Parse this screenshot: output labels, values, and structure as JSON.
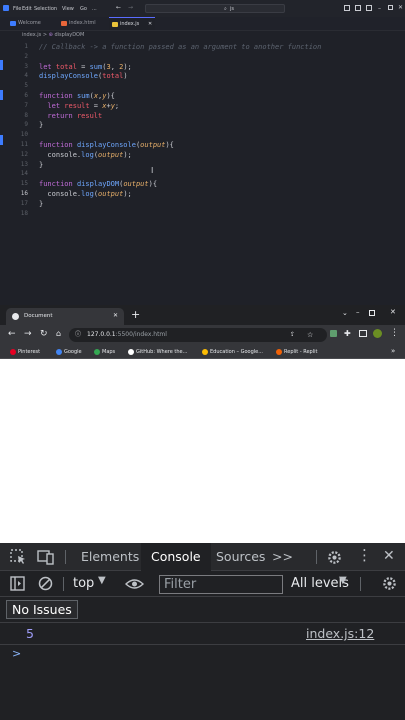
{
  "editor": {
    "menu": [
      "File",
      "Edit",
      "Selection",
      "View",
      "Go",
      "..."
    ],
    "search_placeholder": "js",
    "tabs": [
      {
        "label": "Welcome",
        "active": false
      },
      {
        "label": "index.html",
        "active": false
      },
      {
        "label": "index.js",
        "active": true
      }
    ],
    "breadcrumb": [
      "index.js",
      "displayDOM"
    ],
    "lines": [
      {
        "n": "1",
        "segs": [
          {
            "c": "cm",
            "t": "// Callback -> a function passed as an argument to another function"
          }
        ]
      },
      {
        "n": "2",
        "segs": []
      },
      {
        "n": "3",
        "segs": [
          {
            "c": "kw",
            "t": "let "
          },
          {
            "c": "var",
            "t": "total"
          },
          {
            "c": "p",
            "t": " = "
          },
          {
            "c": "fn",
            "t": "sum"
          },
          {
            "c": "p",
            "t": "("
          },
          {
            "c": "num-lit",
            "t": "3"
          },
          {
            "c": "p",
            "t": ", "
          },
          {
            "c": "num-lit",
            "t": "2"
          },
          {
            "c": "p",
            "t": ");"
          }
        ]
      },
      {
        "n": "4",
        "segs": [
          {
            "c": "fn",
            "t": "displayConsole"
          },
          {
            "c": "p",
            "t": "("
          },
          {
            "c": "var",
            "t": "total"
          },
          {
            "c": "p",
            "t": ")"
          }
        ]
      },
      {
        "n": "5",
        "segs": []
      },
      {
        "n": "6",
        "segs": [
          {
            "c": "kw",
            "t": "function "
          },
          {
            "c": "fn",
            "t": "sum"
          },
          {
            "c": "p",
            "t": "("
          },
          {
            "c": "par",
            "t": "x"
          },
          {
            "c": "p",
            "t": ","
          },
          {
            "c": "par",
            "t": "y"
          },
          {
            "c": "p",
            "t": "){"
          }
        ]
      },
      {
        "n": "7",
        "segs": [
          {
            "c": "kw",
            "t": "  let "
          },
          {
            "c": "var",
            "t": "result"
          },
          {
            "c": "p",
            "t": " = "
          },
          {
            "c": "par",
            "t": "x"
          },
          {
            "c": "p",
            "t": "+"
          },
          {
            "c": "par",
            "t": "y"
          },
          {
            "c": "p",
            "t": ";"
          }
        ]
      },
      {
        "n": "8",
        "segs": [
          {
            "c": "kw",
            "t": "  return "
          },
          {
            "c": "var",
            "t": "result"
          }
        ]
      },
      {
        "n": "9",
        "segs": [
          {
            "c": "p",
            "t": "}"
          }
        ]
      },
      {
        "n": "10",
        "segs": []
      },
      {
        "n": "11",
        "segs": [
          {
            "c": "kw",
            "t": "function "
          },
          {
            "c": "fn",
            "t": "displayConsole"
          },
          {
            "c": "p",
            "t": "("
          },
          {
            "c": "par",
            "t": "output"
          },
          {
            "c": "p",
            "t": "){"
          }
        ]
      },
      {
        "n": "12",
        "segs": [
          {
            "c": "p",
            "t": "  console."
          },
          {
            "c": "fn",
            "t": "log"
          },
          {
            "c": "p",
            "t": "("
          },
          {
            "c": "par",
            "t": "output"
          },
          {
            "c": "p",
            "t": ");"
          }
        ]
      },
      {
        "n": "13",
        "segs": [
          {
            "c": "p",
            "t": "}"
          }
        ]
      },
      {
        "n": "14",
        "segs": []
      },
      {
        "n": "15",
        "segs": [
          {
            "c": "kw",
            "t": "function "
          },
          {
            "c": "fn",
            "t": "displayDOM"
          },
          {
            "c": "p",
            "t": "("
          },
          {
            "c": "par",
            "t": "output"
          },
          {
            "c": "p",
            "t": "){"
          }
        ]
      },
      {
        "n": "16",
        "segs": [
          {
            "c": "p",
            "t": "  console."
          },
          {
            "c": "fn",
            "t": "log"
          },
          {
            "c": "p",
            "t": "("
          },
          {
            "c": "par",
            "t": "output"
          },
          {
            "c": "p",
            "t": ");"
          }
        ]
      },
      {
        "n": "17",
        "segs": [
          {
            "c": "p",
            "t": "}"
          }
        ]
      },
      {
        "n": "18",
        "segs": []
      }
    ],
    "current_line": "16"
  },
  "browser": {
    "tab_title": "Document",
    "new_tab": "+",
    "url_host": "127.0.0.1",
    "url_rest": ":5500/index.html",
    "bookmarks": [
      {
        "label": "Pinterest",
        "color": "#e60023"
      },
      {
        "label": "Google",
        "color": "#4285f4"
      },
      {
        "label": "Maps",
        "color": "#34a853"
      },
      {
        "label": "GitHub: Where the...",
        "color": "#ffffff"
      },
      {
        "label": "Education – Google...",
        "color": "#fbbc04"
      },
      {
        "label": "Replit - Replit",
        "color": "#f26207"
      }
    ],
    "more": "»"
  },
  "devtools": {
    "tabs": [
      "Elements",
      "Console",
      "Sources"
    ],
    "more_tabs": ">>",
    "context": "top",
    "filter_placeholder": "Filter",
    "levels": "All levels",
    "issues": "No Issues",
    "log_value": "5",
    "log_source": "index.js:12",
    "prompt": ">"
  },
  "colors": {
    "accent": "#5a6cff",
    "link_console": "#8ab4f8",
    "value": "#9e9cf8"
  }
}
